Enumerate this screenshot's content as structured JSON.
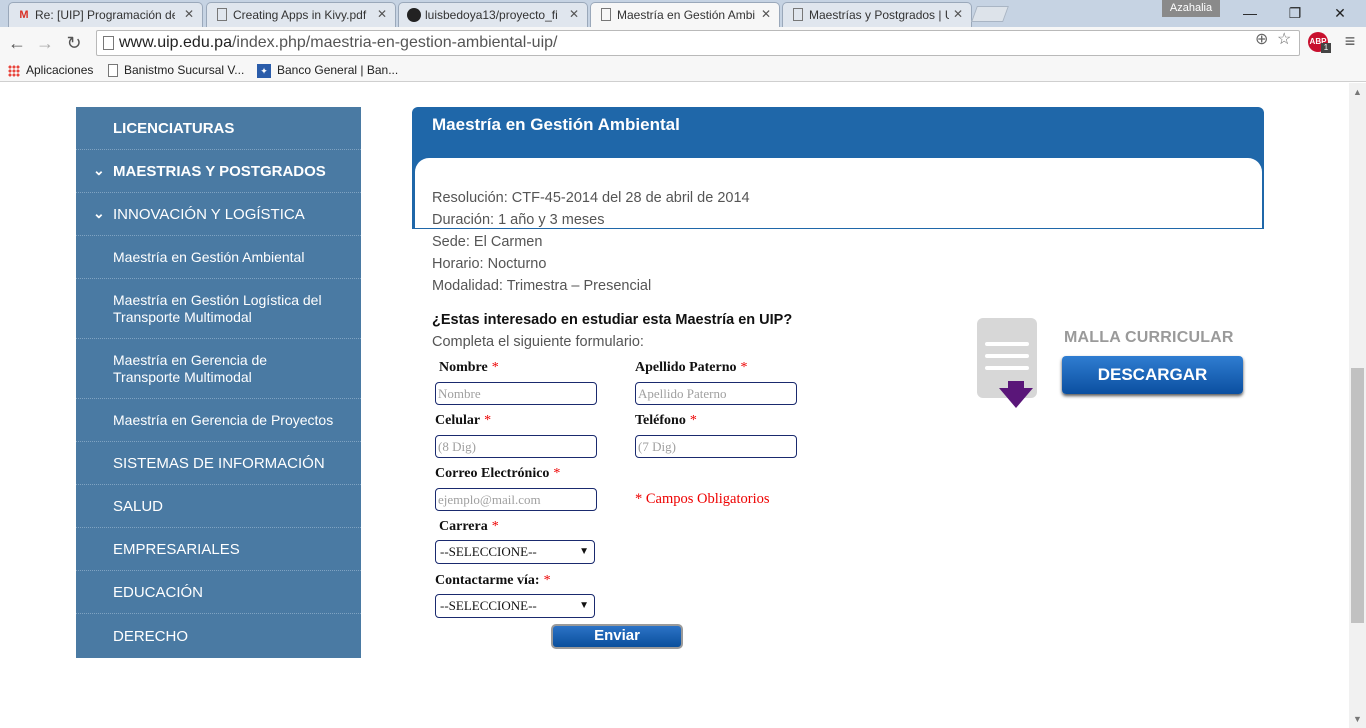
{
  "browser": {
    "tabs": [
      {
        "title": "Re: [UIP] Programación de",
        "icon": "gmail-icon"
      },
      {
        "title": "Creating Apps in Kivy.pdf",
        "icon": "document-icon"
      },
      {
        "title": "luisbedoya13/proyecto_fi",
        "icon": "github-icon"
      },
      {
        "title": "Maestría en Gestión Ambi",
        "icon": "document-icon"
      },
      {
        "title": "Maestrías y Postgrados | U",
        "icon": "document-icon"
      }
    ],
    "close_glyph": "✕",
    "profile_name": "Azahalia",
    "window_controls": {
      "minimize": "—",
      "maximize": "❐",
      "close": "✕"
    },
    "url_host": "www.uip.edu.pa",
    "url_path": "/index.php/maestria-en-gestion-ambiental-uip/",
    "abp_label": "ABP",
    "abp_count": "1",
    "bookmarks": [
      {
        "label": "Aplicaciones"
      },
      {
        "label": "Banistmo Sucursal V..."
      },
      {
        "label": "Banco General | Ban..."
      }
    ]
  },
  "sidebar": {
    "items": [
      {
        "label": "LICENCIATURAS"
      },
      {
        "label": "MAESTRIAS Y POSTGRADOS"
      },
      {
        "label": "INNOVACIÓN Y LOGÍSTICA"
      },
      {
        "label": "Maestría en Gestión Ambiental"
      },
      {
        "label": "Maestría en Gestión Logística del Transporte Multimodal"
      },
      {
        "label": "Maestría en Gerencia de Transporte Multimodal"
      },
      {
        "label": "Maestría en Gerencia de Proyectos"
      },
      {
        "label": "SISTEMAS DE INFORMACIÓN"
      },
      {
        "label": "SALUD"
      },
      {
        "label": "EMPRESARIALES"
      },
      {
        "label": "EDUCACIÓN"
      },
      {
        "label": "DERECHO"
      }
    ]
  },
  "main": {
    "title": "Maestría en Gestión Ambiental",
    "info": [
      "Resolución: CTF-45-2014 del 28 de abril de 2014",
      "Duración: 1 año y 3 meses",
      "Sede: El Carmen",
      "Horario: Nocturno",
      "Modalidad: Trimestra – Presencial"
    ],
    "question": "¿Estas interesado en estudiar esta Maestría en UIP?",
    "subquestion": "Completa el siguiente formulario:"
  },
  "form": {
    "required_mark": "*",
    "nombre": {
      "label": "Nombre",
      "placeholder": "Nombre"
    },
    "apellido": {
      "label": "Apellido Paterno",
      "placeholder": "Apellido Paterno"
    },
    "celular": {
      "label": "Celular",
      "placeholder": "(8 Dig)"
    },
    "telefono": {
      "label": "Teléfono",
      "placeholder": "(7 Dig)"
    },
    "correo": {
      "label": "Correo Electrónico",
      "placeholder": "ejemplo@mail.com"
    },
    "carrera": {
      "label": "Carrera",
      "value": "--SELECCIONE--"
    },
    "contacto": {
      "label": "Contactarme vía:",
      "value": "--SELECCIONE--"
    },
    "required_note": "* Campos Obligatorios",
    "submit": "Enviar"
  },
  "malla": {
    "title": "MALLA CURRICULAR",
    "button": "DESCARGAR"
  },
  "colors": {
    "sidebar_bg": "#4a7aa3",
    "panel_header": "#1f67a9",
    "required": "#e00000",
    "download_icon_arrow": "#5a1679"
  }
}
